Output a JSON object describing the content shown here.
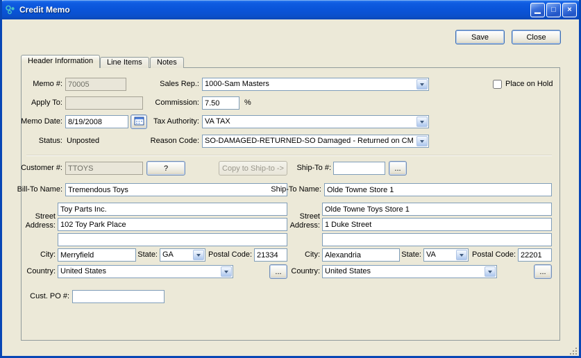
{
  "window": {
    "title": "Credit Memo",
    "controls": {
      "minimize": "▁",
      "maximize": "□",
      "close": "×"
    }
  },
  "actions": {
    "save": "Save",
    "close": "Close"
  },
  "tabs": {
    "header_information": "Header Information",
    "line_items": "Line Items",
    "notes": "Notes"
  },
  "fields": {
    "memo_no": {
      "label": "Memo #:",
      "value": "70005"
    },
    "sales_rep": {
      "label": "Sales Rep.:",
      "value": "1000-Sam Masters"
    },
    "place_on_hold": {
      "label": "Place on Hold"
    },
    "apply_to": {
      "label": "Apply To:",
      "value": ""
    },
    "commission": {
      "label": "Commission:",
      "value": "7.50",
      "unit": "%"
    },
    "memo_date": {
      "label": "Memo Date:",
      "value": "8/19/2008"
    },
    "tax_authority": {
      "label": "Tax Authority:",
      "value": "VA TAX"
    },
    "status": {
      "label": "Status:",
      "value": "Unposted"
    },
    "reason_code": {
      "label": "Reason Code:",
      "value": "SO-DAMAGED-RETURNED-SO Damaged - Returned on CM"
    },
    "customer_no": {
      "label": "Customer #:",
      "value": "TTOYS",
      "help": "?"
    },
    "copy_to_shipto": {
      "label": "Copy to Ship-to ->"
    },
    "ship_to_no": {
      "label": "Ship-To #:",
      "value": "",
      "browse": "..."
    },
    "cust_po": {
      "label": "Cust. PO #:",
      "value": ""
    }
  },
  "bill_to": {
    "name_label": "Bill-To Name:",
    "name": "Tremendous Toys",
    "street_label": "Street Address:",
    "street1": "Toy Parts Inc.",
    "street2": "102 Toy Park Place",
    "street3": "",
    "city_label": "City:",
    "city": "Merryfield",
    "state_label": "State:",
    "state": "GA",
    "postal_label": "Postal Code:",
    "postal": "21334",
    "country_label": "Country:",
    "country": "United States",
    "browse": "..."
  },
  "ship_to": {
    "name_label": "Ship-To Name:",
    "name": "Olde Towne Store 1",
    "street_label": "Street Address:",
    "street1": "Olde Towne Toys Store 1",
    "street2": "1 Duke Street",
    "street3": "",
    "city_label": "City:",
    "city": "Alexandria",
    "state_label": "State:",
    "state": "VA",
    "postal_label": "Postal Code:",
    "postal": "22201",
    "country_label": "Country:",
    "country": "United States",
    "browse": "..."
  }
}
